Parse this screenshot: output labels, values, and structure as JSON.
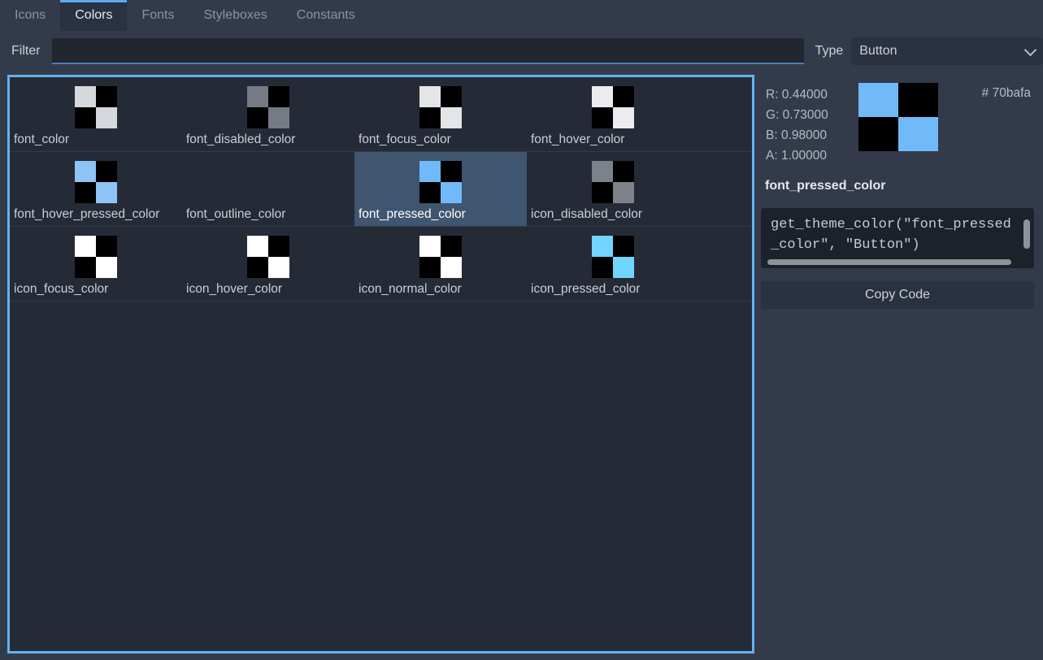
{
  "tabs": [
    {
      "label": "Icons",
      "active": false
    },
    {
      "label": "Colors",
      "active": true
    },
    {
      "label": "Fonts",
      "active": false
    },
    {
      "label": "Styleboxes",
      "active": false
    },
    {
      "label": "Constants",
      "active": false
    }
  ],
  "filter": {
    "label": "Filter",
    "value": "",
    "placeholder": ""
  },
  "type": {
    "label": "Type",
    "selected": "Button",
    "options": [
      "Button"
    ]
  },
  "grid": {
    "rows": [
      [
        {
          "label": "font_color",
          "color": "#d5d8dc",
          "selected": false
        },
        {
          "label": "font_disabled_color",
          "color": "#757a85",
          "selected": false
        },
        {
          "label": "font_focus_color",
          "color": "#e3e5e8",
          "selected": false
        },
        {
          "label": "font_hover_color",
          "color": "#eaecef",
          "selected": false
        }
      ],
      [
        {
          "label": "font_hover_pressed_color",
          "color": "#8ec4f5",
          "selected": false
        },
        {
          "label": "font_outline_color",
          "color": "",
          "selected": false
        },
        {
          "label": "font_pressed_color",
          "color": "#70bafa",
          "selected": true
        },
        {
          "label": "icon_disabled_color",
          "color": "#7d8189",
          "selected": false
        }
      ],
      [
        {
          "label": "icon_focus_color",
          "color": "#ffffff",
          "selected": false
        },
        {
          "label": "icon_hover_color",
          "color": "#ffffff",
          "selected": false
        },
        {
          "label": "icon_normal_color",
          "color": "#ffffff",
          "selected": false
        },
        {
          "label": "icon_pressed_color",
          "color": "#71d5ff",
          "selected": false
        }
      ]
    ]
  },
  "detail": {
    "r": "R: 0.44000",
    "g": "G: 0.73000",
    "b": "B: 0.98000",
    "a": "A: 1.00000",
    "hex": "# 70bafa",
    "swatch_color": "#70bafa",
    "property_name": "font_pressed_color",
    "code": "get_theme_color(\"font_pressed_color\", \"Button\")",
    "copy_label": "Copy Code"
  },
  "colors": {
    "accent": "#63b3f0",
    "background": "#333b4a",
    "panel": "#252b36",
    "selection": "#3f5570"
  }
}
